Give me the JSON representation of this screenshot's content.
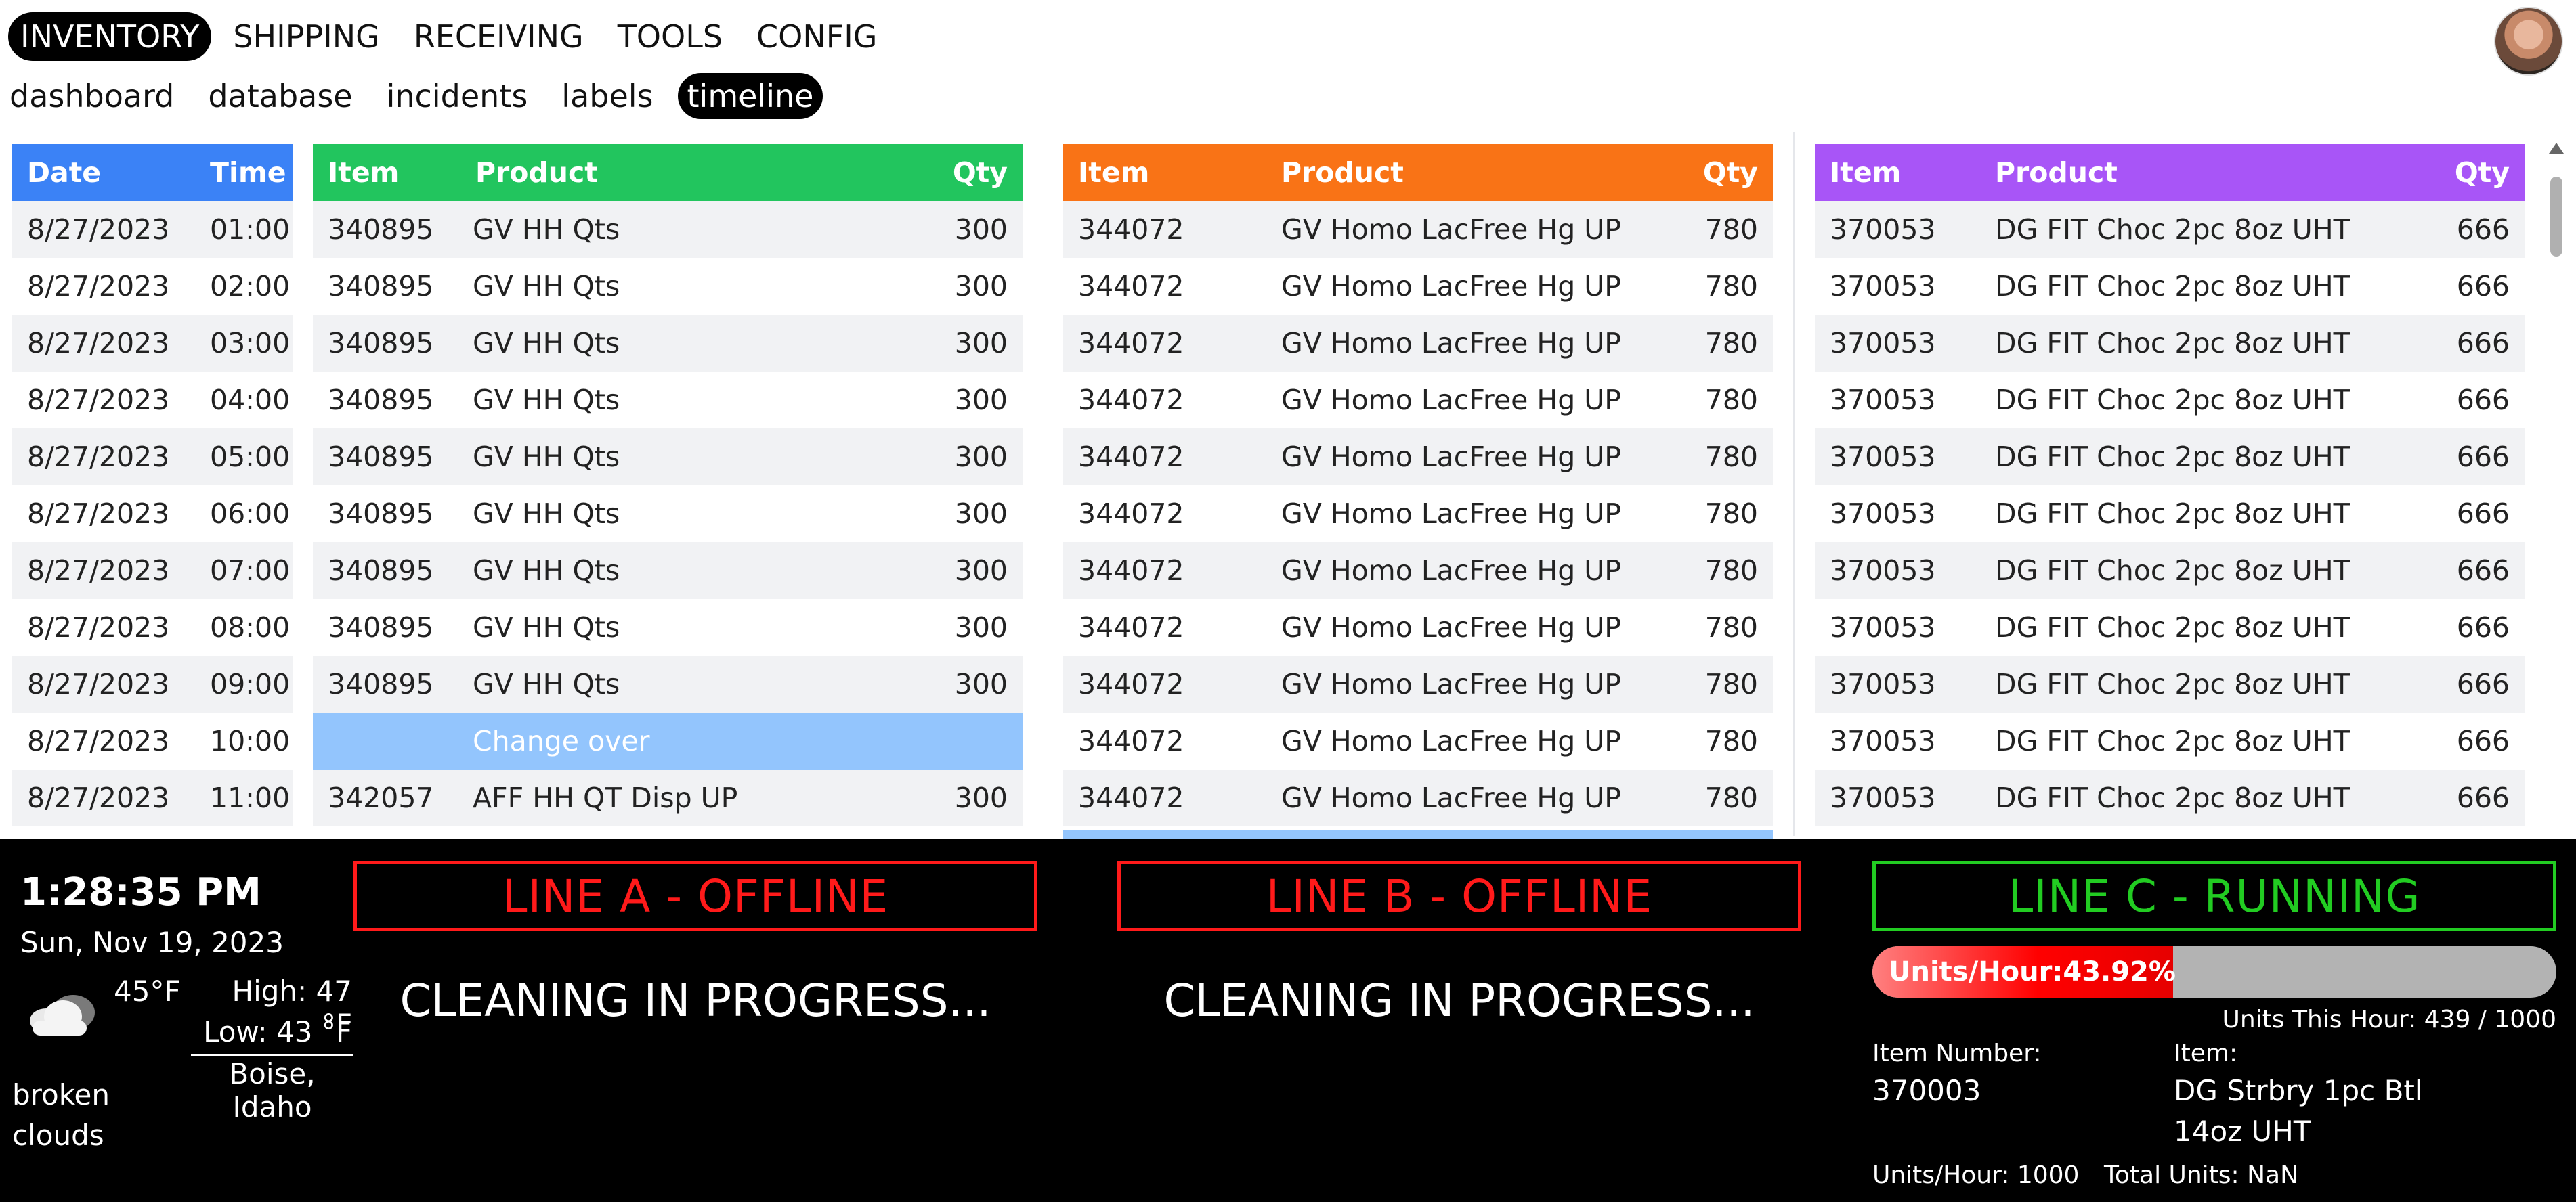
{
  "nav": {
    "primary": [
      "INVENTORY",
      "SHIPPING",
      "RECEIVING",
      "TOOLS",
      "CONFIG"
    ],
    "secondary": [
      "dashboard",
      "database",
      "incidents",
      "labels",
      "timeline"
    ],
    "primary_active": "INVENTORY",
    "secondary_active": "timeline"
  },
  "schedule": {
    "headers": {
      "date": "Date",
      "time": "Time"
    },
    "rows": [
      [
        "8/27/2023",
        "01:00"
      ],
      [
        "8/27/2023",
        "02:00"
      ],
      [
        "8/27/2023",
        "03:00"
      ],
      [
        "8/27/2023",
        "04:00"
      ],
      [
        "8/27/2023",
        "05:00"
      ],
      [
        "8/27/2023",
        "06:00"
      ],
      [
        "8/27/2023",
        "07:00"
      ],
      [
        "8/27/2023",
        "08:00"
      ],
      [
        "8/27/2023",
        "09:00"
      ],
      [
        "8/27/2023",
        "10:00"
      ],
      [
        "8/27/2023",
        "11:00"
      ]
    ]
  },
  "line_a": {
    "headers": {
      "item": "Item",
      "product": "Product",
      "qty": "Qty"
    },
    "color": "#22c55e",
    "rows": [
      [
        "340895",
        "GV HH Qts",
        "300"
      ],
      [
        "340895",
        "GV HH Qts",
        "300"
      ],
      [
        "340895",
        "GV HH Qts",
        "300"
      ],
      [
        "340895",
        "GV HH Qts",
        "300"
      ],
      [
        "340895",
        "GV HH Qts",
        "300"
      ],
      [
        "340895",
        "GV HH Qts",
        "300"
      ],
      [
        "340895",
        "GV HH Qts",
        "300"
      ],
      [
        "340895",
        "GV HH Qts",
        "300"
      ],
      [
        "340895",
        "GV HH Qts",
        "300"
      ],
      [
        "",
        "Change over",
        ""
      ],
      [
        "342057",
        "AFF HH QT Disp UP",
        "300"
      ]
    ]
  },
  "line_b": {
    "headers": {
      "item": "Item",
      "product": "Product",
      "qty": "Qty"
    },
    "color": "#f97316",
    "rows": [
      [
        "344072",
        "GV Homo LacFree Hg UP",
        "780"
      ],
      [
        "344072",
        "GV Homo LacFree Hg UP",
        "780"
      ],
      [
        "344072",
        "GV Homo LacFree Hg UP",
        "780"
      ],
      [
        "344072",
        "GV Homo LacFree Hg UP",
        "780"
      ],
      [
        "344072",
        "GV Homo LacFree Hg UP",
        "780"
      ],
      [
        "344072",
        "GV Homo LacFree Hg UP",
        "780"
      ],
      [
        "344072",
        "GV Homo LacFree Hg UP",
        "780"
      ],
      [
        "344072",
        "GV Homo LacFree Hg UP",
        "780"
      ],
      [
        "344072",
        "GV Homo LacFree Hg UP",
        "780"
      ],
      [
        "344072",
        "GV Homo LacFree Hg UP",
        "780"
      ],
      [
        "344072",
        "GV Homo LacFree Hg UP",
        "780"
      ]
    ]
  },
  "line_c": {
    "headers": {
      "item": "Item",
      "product": "Product",
      "qty": "Qty"
    },
    "color": "#a855f7",
    "rows": [
      [
        "370053",
        "DG FIT Choc 2pc 8oz UHT",
        "666"
      ],
      [
        "370053",
        "DG FIT Choc 2pc 8oz UHT",
        "666"
      ],
      [
        "370053",
        "DG FIT Choc 2pc 8oz UHT",
        "666"
      ],
      [
        "370053",
        "DG FIT Choc 2pc 8oz UHT",
        "666"
      ],
      [
        "370053",
        "DG FIT Choc 2pc 8oz UHT",
        "666"
      ],
      [
        "370053",
        "DG FIT Choc 2pc 8oz UHT",
        "666"
      ],
      [
        "370053",
        "DG FIT Choc 2pc 8oz UHT",
        "666"
      ],
      [
        "370053",
        "DG FIT Choc 2pc 8oz UHT",
        "666"
      ],
      [
        "370053",
        "DG FIT Choc 2pc 8oz UHT",
        "666"
      ],
      [
        "370053",
        "DG FIT Choc 2pc 8oz UHT",
        "666"
      ],
      [
        "370053",
        "DG FIT Choc 2pc 8oz UHT",
        "666"
      ]
    ]
  },
  "status": {
    "time": "1:28:35 PM",
    "date": "Sun, Nov 19, 2023",
    "weather": {
      "icon": "cloud-icon",
      "temp": "45°F",
      "high": "High: 47 °F",
      "low": "Low: 43 °F",
      "location": "Boise, Idaho",
      "description": "broken clouds"
    },
    "line_a": {
      "title": "LINE A - OFFLINE",
      "message": "CLEANING IN PROGRESS...",
      "color": "#ff1a1a"
    },
    "line_b": {
      "title": "LINE B - OFFLINE",
      "message": "CLEANING IN PROGRESS...",
      "color": "#ff1a1a"
    },
    "line_c": {
      "title": "LINE C - RUNNING",
      "color": "#22cc22",
      "progress_label": "Units/Hour:43.92%",
      "progress_fraction": 0.4392,
      "units_this_hour": "Units This Hour: 439 / 1000",
      "item_number_label": "Item Number:",
      "item_number": "370003",
      "item_label": "Item:",
      "item": "DG Strbry 1pc Btl 14oz UHT",
      "units_per_hour": "Units/Hour: 1000",
      "total_units": "Total Units: NaN"
    }
  }
}
